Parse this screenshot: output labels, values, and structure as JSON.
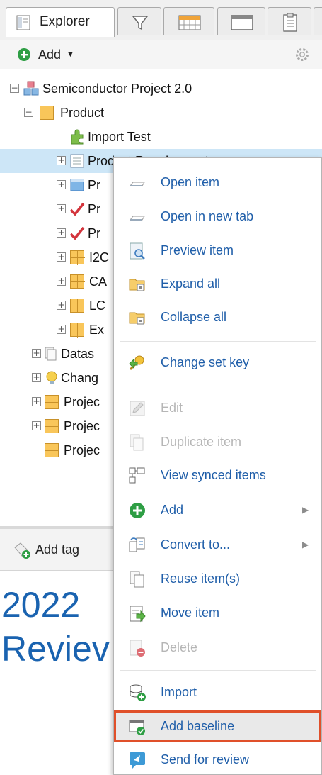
{
  "tabs": {
    "explorer_label": "Explorer",
    "icons": [
      "explorer-icon",
      "filter-icon",
      "grid-view-icon",
      "window-icon",
      "clipboard-icon"
    ]
  },
  "toolbar": {
    "add_label": "Add",
    "add_icon": "plus-circle-icon",
    "settings_icon": "gear-icon"
  },
  "tree": {
    "root": "Semiconductor Project 2.0",
    "product": "Product",
    "import_test": "Import Test",
    "product_requirements": "Product Requirements",
    "child_pr": "Pr",
    "child_pr2": "Pr",
    "child_pr3": "Pr",
    "i2c": "I2C",
    "ca": "CA",
    "lc": "LC",
    "ex": "Ex",
    "datasets": "Datas",
    "change": "Chang",
    "project1": "Projec",
    "project2": "Projec",
    "project3": "Projec"
  },
  "panel": {
    "add_tag_label": "Add tag",
    "title_line1": "2022",
    "title_line2": "Reviev"
  },
  "context_menu": {
    "items": [
      {
        "label": "Open item",
        "icon": "open-item-icon",
        "enabled": true
      },
      {
        "label": "Open in new tab",
        "icon": "new-tab-icon",
        "enabled": true
      },
      {
        "label": "Preview item",
        "icon": "preview-icon",
        "enabled": true
      },
      {
        "label": "Expand all",
        "icon": "expand-folder-icon",
        "enabled": true
      },
      {
        "label": "Collapse all",
        "icon": "collapse-folder-icon",
        "enabled": true
      },
      {
        "label": "Change set key",
        "icon": "change-set-key-icon",
        "enabled": true
      },
      {
        "label": "Edit",
        "icon": "pencil-icon",
        "enabled": false
      },
      {
        "label": "Duplicate item",
        "icon": "duplicate-icon",
        "enabled": false
      },
      {
        "label": "View synced items",
        "icon": "synced-items-icon",
        "enabled": true
      },
      {
        "label": "Add",
        "icon": "plus-circle-icon",
        "enabled": true,
        "submenu": true
      },
      {
        "label": "Convert to...",
        "icon": "convert-icon",
        "enabled": true,
        "submenu": true
      },
      {
        "label": "Reuse item(s)",
        "icon": "reuse-icon",
        "enabled": true
      },
      {
        "label": "Move item",
        "icon": "move-item-icon",
        "enabled": true
      },
      {
        "label": "Delete",
        "icon": "delete-icon",
        "enabled": false
      },
      {
        "label": "Import",
        "icon": "import-icon",
        "enabled": true
      },
      {
        "label": "Add baseline",
        "icon": "add-baseline-icon",
        "enabled": true,
        "highlighted": true
      },
      {
        "label": "Send for review",
        "icon": "send-review-icon",
        "enabled": true
      }
    ]
  },
  "colors": {
    "accent_text": "#1f5ea9",
    "title_blue": "#1a63b0",
    "selection": "#cde6f7",
    "highlight_border": "#e0502a",
    "disabled_text": "#b6b6b6",
    "add_green": "#2e9e44"
  }
}
